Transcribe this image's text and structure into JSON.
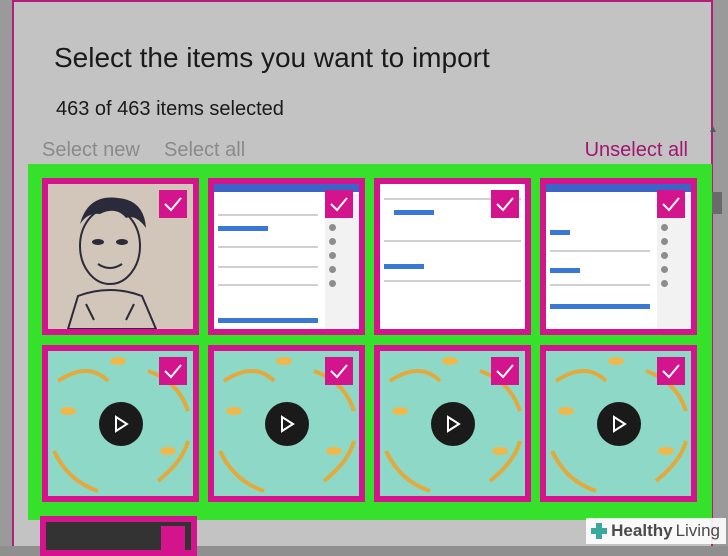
{
  "dialog": {
    "title": "Select the items you want to import",
    "selection_count": "463 of 463 items selected",
    "select_new": "Select new",
    "select_all": "Select all",
    "unselect_all": "Unselect all"
  },
  "tiles": [
    {
      "kind": "photo",
      "icon": "check-icon"
    },
    {
      "kind": "screenshot",
      "icon": "check-icon"
    },
    {
      "kind": "screenshot",
      "icon": "check-icon"
    },
    {
      "kind": "screenshot",
      "icon": "check-icon"
    },
    {
      "kind": "video",
      "icon": "play-icon"
    },
    {
      "kind": "video",
      "icon": "play-icon"
    },
    {
      "kind": "video",
      "icon": "play-icon"
    },
    {
      "kind": "video",
      "icon": "play-icon"
    }
  ],
  "colors": {
    "accent": "#d4148c",
    "highlight": "#36e12c",
    "link_active": "#a01670"
  },
  "watermark": {
    "word1": "Healthy",
    "word2": "Living"
  }
}
